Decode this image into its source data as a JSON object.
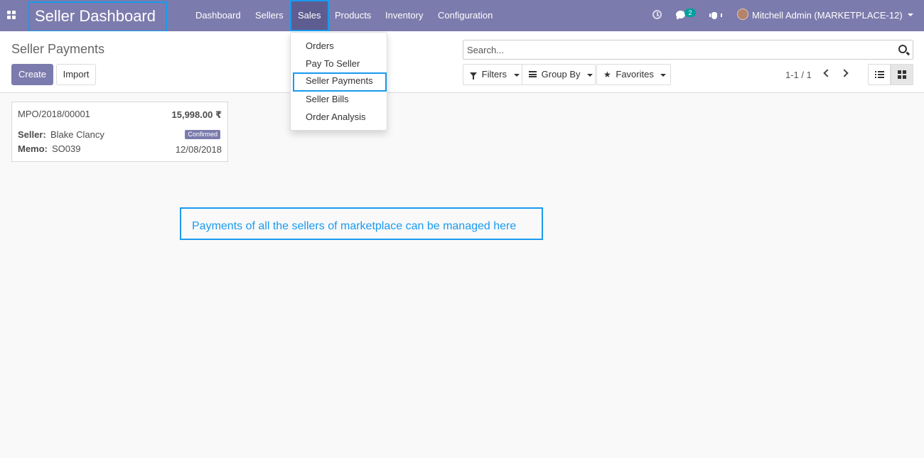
{
  "navbar": {
    "app_title": "Seller Dashboard",
    "menu": [
      {
        "label": "Dashboard"
      },
      {
        "label": "Sellers"
      },
      {
        "label": "Sales"
      },
      {
        "label": "Products"
      },
      {
        "label": "Inventory"
      },
      {
        "label": "Configuration"
      }
    ],
    "active_menu": "Sales",
    "chat_count": "2",
    "user": "Mitchell Admin (MARKETPLACE-12)",
    "accent_color": "#7c7bad",
    "highlight_color": "#1a9aef"
  },
  "sales_dropdown": {
    "items": [
      {
        "label": "Orders"
      },
      {
        "label": "Pay To Seller"
      },
      {
        "label": "Seller Payments"
      },
      {
        "label": "Seller Bills"
      },
      {
        "label": "Order Analysis"
      }
    ],
    "selected": "Seller Payments"
  },
  "control_panel": {
    "title": "Seller Payments",
    "create_label": "Create",
    "import_label": "Import",
    "search_placeholder": "Search...",
    "filters_label": "Filters",
    "group_by_label": "Group By",
    "favorites_label": "Favorites",
    "pager_value": "1-1 / 1",
    "active_view": "kanban"
  },
  "records": [
    {
      "reference": "MPO/2018/00001",
      "amount": "15,998.00 ₹",
      "seller_label": "Seller:",
      "seller": "Blake Clancy",
      "state": "Confirmed",
      "memo_label": "Memo:",
      "memo": "SO039",
      "date": "12/08/2018"
    }
  ],
  "annotation": {
    "text": "Payments of all the sellers of marketplace can be managed here"
  }
}
